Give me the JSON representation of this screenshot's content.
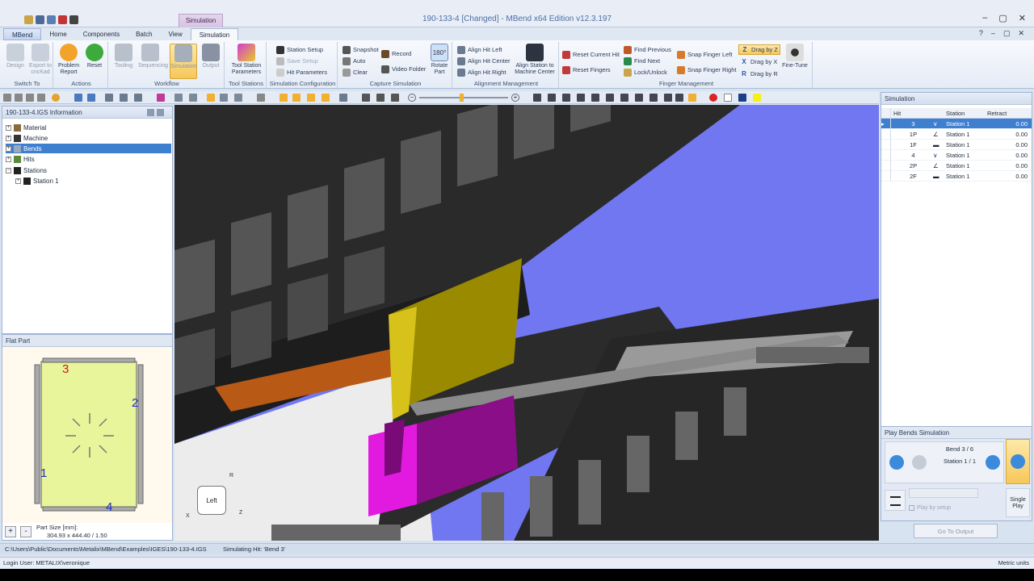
{
  "window": {
    "title": "190-133-4 [Changed] - MBend x64 Edition v12.3.197",
    "context_tab": "Simulation"
  },
  "tabs": [
    "MBend",
    "Home",
    "Components",
    "Batch",
    "View",
    "Simulation"
  ],
  "ribbon": {
    "switch_to": {
      "label": "Switch To",
      "design": "Design",
      "export": "Export to cncKad"
    },
    "actions": {
      "label": "Actions",
      "problem": "Problem Report",
      "reset": "Reset"
    },
    "workflow": {
      "label": "Workflow",
      "tooling": "Tooling",
      "sequencing": "Sequencing",
      "simulation": "Simulation",
      "output": "Output"
    },
    "tool_stations": {
      "label": "Tool Stations",
      "params": "Tool Station Parameters"
    },
    "sim_config": {
      "label": "Simulation Configuration",
      "setup": "Station Setup",
      "save": "Save Setup",
      "hit": "Hit Parameters"
    },
    "capture": {
      "label": "Capture Simulation",
      "snapshot": "Snapshot",
      "auto": "Auto",
      "clear": "Clear",
      "record": "Record",
      "video": "Video Folder",
      "rotate": "Rotate Part"
    },
    "alignment": {
      "label": "Alignment Management",
      "left": "Align Hit Left",
      "center": "Align Hit Center",
      "right": "Align Hit Right",
      "machine": "Align Station to Machine Center"
    },
    "finger": {
      "label": "Finger Management",
      "reset_current": "Reset Current Hit",
      "reset_fingers": "Reset Fingers",
      "find_prev": "Find Previous",
      "find_next": "Find Next",
      "lock": "Lock/Unlock",
      "snap_left": "Snap Finger Left",
      "snap_right": "Snap Finger Right",
      "drag_z": "Drag by Z",
      "drag_x": "Drag by X",
      "drag_r": "Drag by R",
      "fine": "Fine-Tune"
    }
  },
  "info_panel": {
    "title": "190-133-4.IGS Information",
    "items": [
      "Material",
      "Machine",
      "Bends",
      "Hits",
      "Stations",
      "Station 1"
    ]
  },
  "flat_part": {
    "title": "Flat Part",
    "labels": [
      "3",
      "2",
      "1",
      "4"
    ],
    "size_label": "Part Size [mm]:",
    "size_value": "304.93 x 444.40 / 1.50"
  },
  "view_cube": {
    "face": "Left",
    "axes": [
      "R",
      "X",
      "Z"
    ]
  },
  "simulation": {
    "title": "Simulation",
    "headers": [
      "Hit",
      "Station",
      "Retract"
    ],
    "rows": [
      {
        "hit": "3",
        "icon": "v-icon",
        "station": "Station 1",
        "retract": "0.00"
      },
      {
        "hit": "1P",
        "icon": "angle-icon",
        "station": "Station 1",
        "retract": "0.00"
      },
      {
        "hit": "1F",
        "icon": "flat-icon",
        "station": "Station 1",
        "retract": "0.00"
      },
      {
        "hit": "4",
        "icon": "v-icon",
        "station": "Station 1",
        "retract": "0.00"
      },
      {
        "hit": "2P",
        "icon": "angle-icon",
        "station": "Station 1",
        "retract": "0.00"
      },
      {
        "hit": "2F",
        "icon": "flat-icon",
        "station": "Station 1",
        "retract": "0.00"
      }
    ]
  },
  "play": {
    "title": "Play Bends Simulation",
    "bend": "Bend 3 / 6",
    "station": "Station 1 / 1",
    "play_by_setup": "Play by setup",
    "single_play": "Single Play",
    "go_output": "Go To Output"
  },
  "status": {
    "path": "C:\\Users\\Public\\Documents\\Metalix\\MBend\\Examples\\IGES\\190-133-4.IGS",
    "simulating": "Simulating Hit: 'Bend 3'",
    "login": "Login User: METALIX\\veronique",
    "units": "Metric units"
  },
  "colors": {
    "accent": "#3f7fd0",
    "sheet": "#e8f59a",
    "viewport_bg": "#7077f0",
    "die": "#e21ae0",
    "punch": "#d6c21a"
  }
}
